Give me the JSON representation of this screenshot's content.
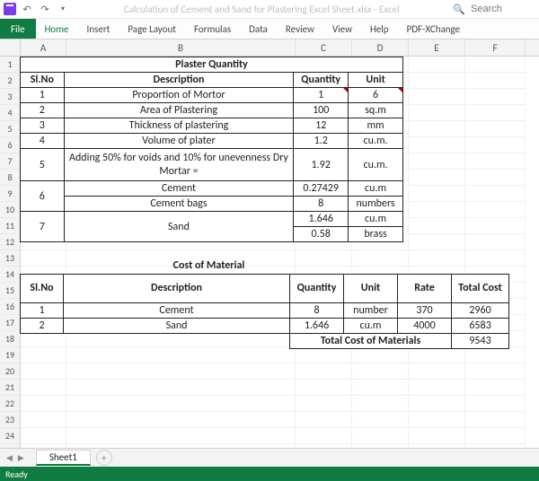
{
  "app": {
    "title": "Calculation of Cement and Sand for Plastering Excel Sheet.xlsx  -  Excel",
    "search_placeholder": "Search"
  },
  "ribbon": {
    "file": "File",
    "tabs": [
      "Home",
      "Insert",
      "Page Layout",
      "Formulas",
      "Data",
      "Review",
      "View",
      "Help",
      "PDF-XChange"
    ]
  },
  "columns": [
    "A",
    "B",
    "C",
    "D",
    "E",
    "F"
  ],
  "row_count": 25,
  "sheet_tab": "Sheet1",
  "status": "Ready",
  "table1": {
    "title": "Plaster Quantity",
    "headers": {
      "slno": "Sl.No",
      "desc": "Description",
      "qty": "Quantity",
      "unit": "Unit"
    },
    "rows": [
      {
        "slno": "1",
        "desc": "Proportion of Mortor",
        "qty": "1",
        "unit": "6"
      },
      {
        "slno": "2",
        "desc": "Area of Plastering",
        "qty": "100",
        "unit": "sq.m"
      },
      {
        "slno": "3",
        "desc": "Thickness of plastering",
        "qty": "12",
        "unit": "mm"
      },
      {
        "slno": "4",
        "desc": "Volume of plater",
        "qty": "1.2",
        "unit": "cu.m."
      }
    ],
    "row5": {
      "slno": "5",
      "desc": "Adding 50% for voids and 10% for unevenness Dry Mortar =",
      "qty": "1.92",
      "unit": "cu.m."
    },
    "row6a": {
      "slno": "6",
      "desc": "Cement",
      "qty": "0.27429",
      "unit": "cu.m"
    },
    "row6b": {
      "desc": "Cement bags",
      "qty": "8",
      "unit": "numbers"
    },
    "row7a": {
      "slno": "7",
      "desc": "Sand",
      "qty": "1.646",
      "unit": "cu.m"
    },
    "row7b": {
      "qty": "0.58",
      "unit": "brass"
    }
  },
  "table2": {
    "title": "Cost of Material",
    "headers": {
      "slno": "Sl.No",
      "desc": "Description",
      "qty": "Quantity",
      "unit": "Unit",
      "rate": "Rate",
      "total": "Total Cost"
    },
    "rows": [
      {
        "slno": "1",
        "desc": "Cement",
        "qty": "8",
        "unit": "number",
        "rate": "370",
        "total": "2960"
      },
      {
        "slno": "2",
        "desc": "Sand",
        "qty": "1.646",
        "unit": "cu.m",
        "rate": "4000",
        "total": "6583"
      }
    ],
    "total_label": "Total Cost of Materials",
    "total_value": "9543"
  }
}
